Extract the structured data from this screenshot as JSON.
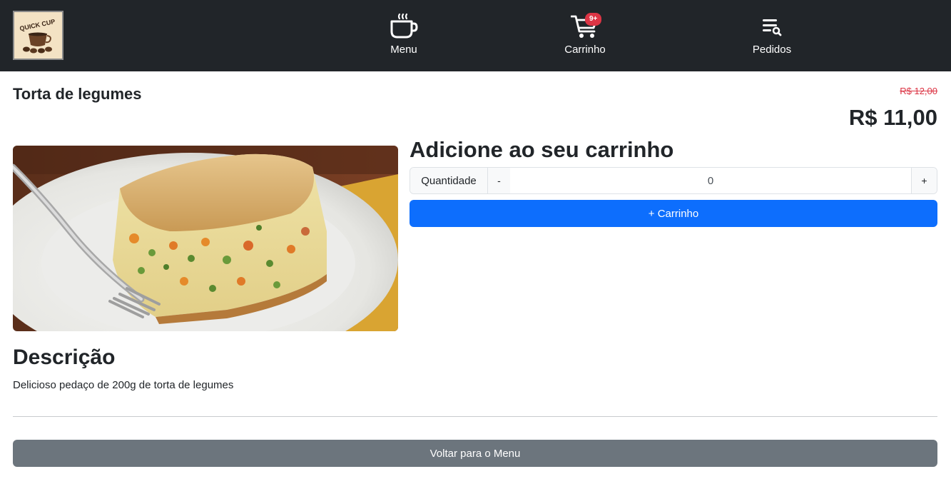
{
  "navbar": {
    "logo_text": "QUICK CUP",
    "items": [
      {
        "label": "Menu",
        "icon": "coffee-cup-icon"
      },
      {
        "label": "Carrinho",
        "icon": "cart-icon",
        "badge": "9+"
      },
      {
        "label": "Pedidos",
        "icon": "order-list-icon"
      }
    ]
  },
  "product": {
    "name": "Torta de legumes",
    "old_price": "R$ 12,00",
    "price": "R$ 11,00",
    "image_alt": "vegetable pie slice on plate with fork"
  },
  "add_to_cart": {
    "heading": "Adicione ao seu carrinho",
    "quantity_label": "Quantidade",
    "decrement_label": "-",
    "increment_label": "+",
    "quantity_value": "0",
    "button_label": "+ Carrinho"
  },
  "description": {
    "heading": "Descrição",
    "text": "Delicioso pedaço de 200g de torta de legumes"
  },
  "back_button_label": "Voltar para o Menu",
  "colors": {
    "navbar_bg": "#212529",
    "primary": "#0d6efd",
    "secondary": "#6c757d",
    "danger": "#dc3545"
  }
}
